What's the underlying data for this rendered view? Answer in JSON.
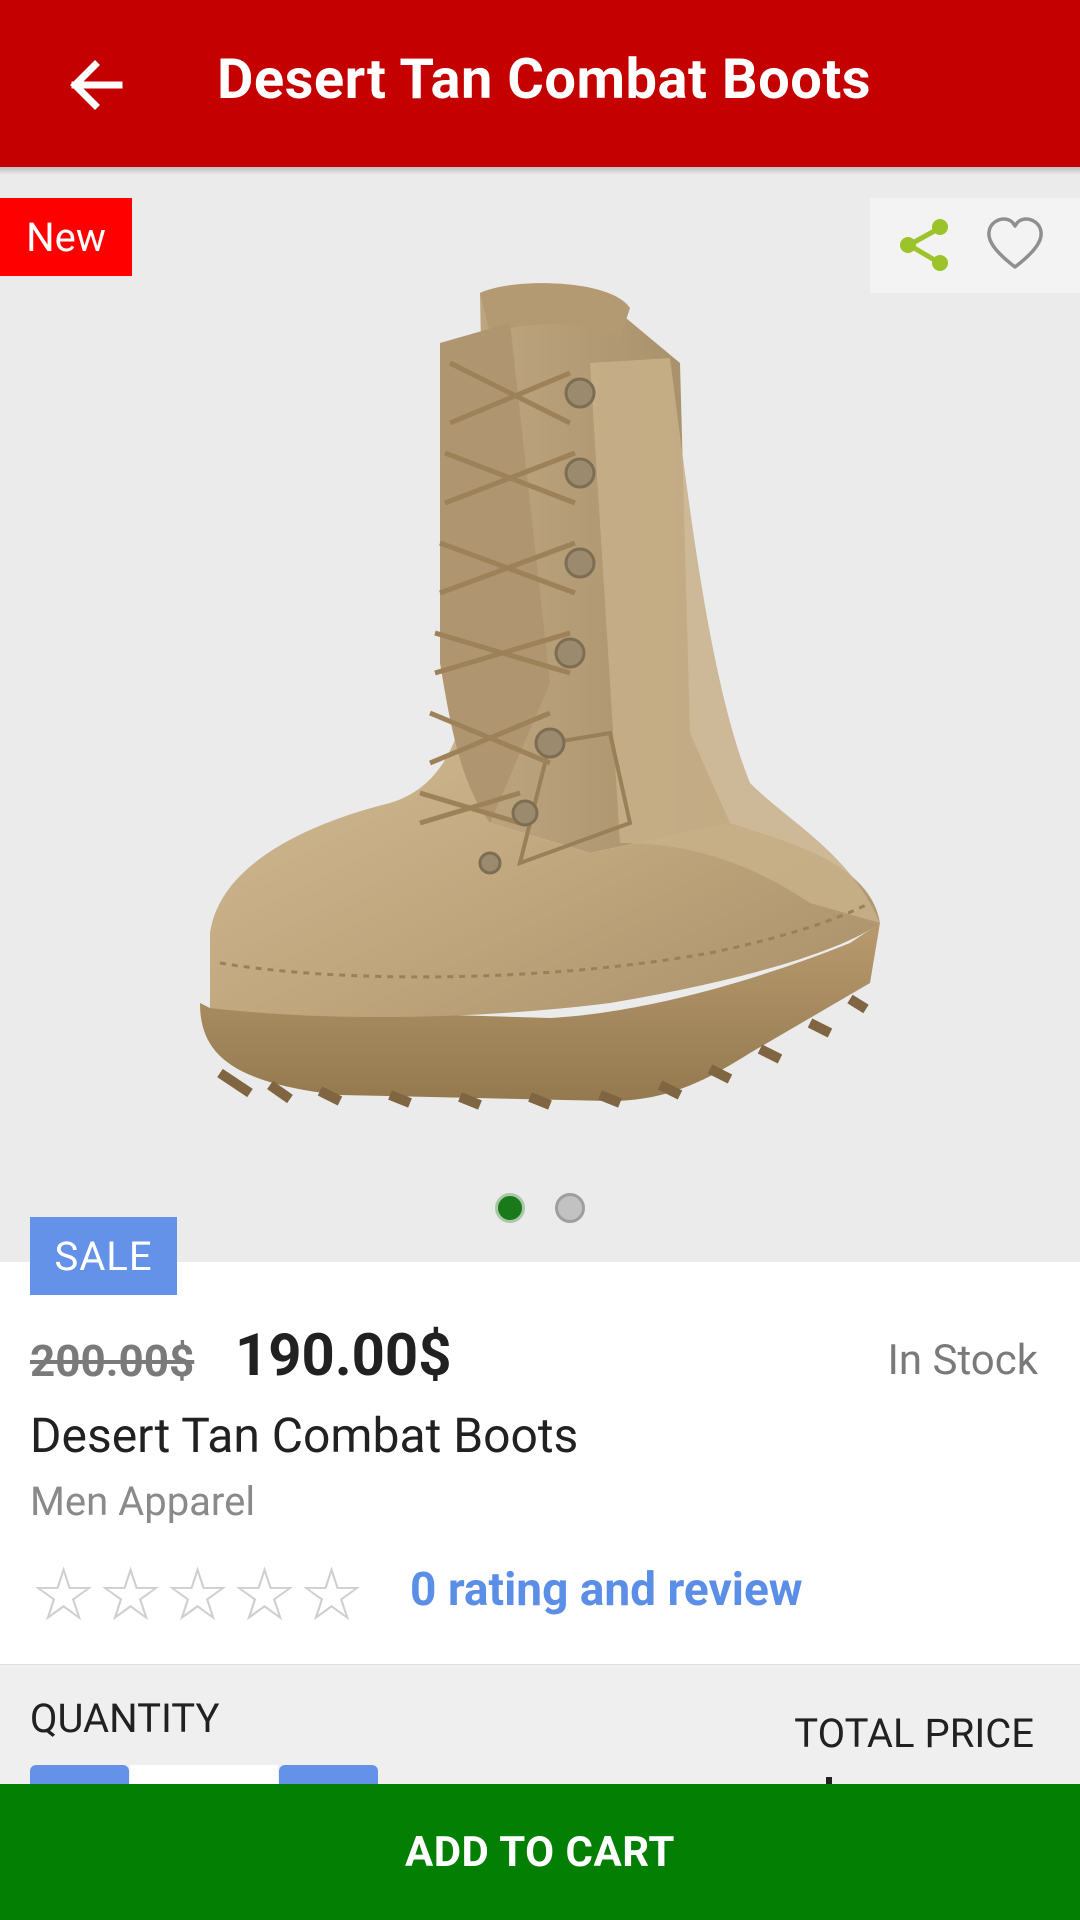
{
  "header": {
    "title": "Desert Tan Combat Boots"
  },
  "gallery": {
    "badge": "New",
    "image_count": 2,
    "active_image": 1
  },
  "product": {
    "sale_label": "SALE",
    "old_price": "200.00$",
    "price": "190.00$",
    "stock_status": "In Stock",
    "name": "Desert Tan Combat Boots",
    "category": "Men Apparel",
    "rating": 0,
    "rating_max": 5,
    "star_glyph": "☆",
    "reviews_text": "0 rating and review"
  },
  "quantity": {
    "label": "QUANTITY",
    "total_label": "TOTAL PRICE"
  },
  "actions": {
    "add_to_cart": "ADD TO CART"
  },
  "colors": {
    "app_bar": "#c40000",
    "new_badge": "#ff0000",
    "sale_badge": "#6492e8",
    "link": "#5b8ee6",
    "cart_button": "#038003",
    "share_icon": "#9cc42a"
  },
  "icons": {
    "back": "arrow-left-icon",
    "share": "share-icon",
    "favorite": "heart-outline-icon",
    "star": "star-outline-icon"
  }
}
